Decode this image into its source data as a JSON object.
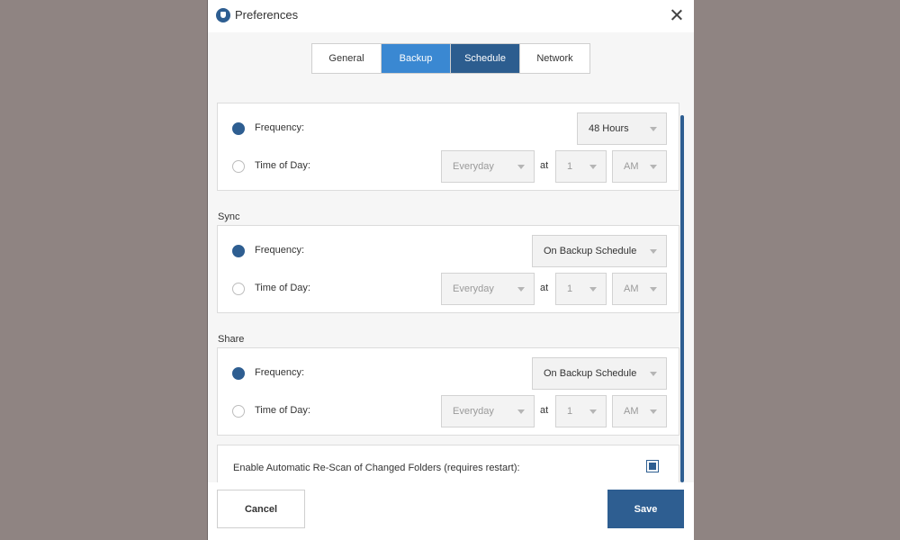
{
  "window": {
    "title": "Preferences"
  },
  "tabs": [
    "General",
    "Backup",
    "Schedule",
    "Network"
  ],
  "sections": {
    "backup": {
      "label": "",
      "frequency_label": "Frequency:",
      "frequency_value": "48 Hours",
      "time_label": "Time of Day:",
      "day_value": "Everyday",
      "at_label": "at",
      "hour_value": "1",
      "ampm_value": "AM"
    },
    "sync": {
      "label": "Sync",
      "frequency_label": "Frequency:",
      "frequency_value": "On Backup Schedule",
      "time_label": "Time of Day:",
      "day_value": "Everyday",
      "at_label": "at",
      "hour_value": "1",
      "ampm_value": "AM"
    },
    "share": {
      "label": "Share",
      "frequency_label": "Frequency:",
      "frequency_value": "On Backup Schedule",
      "time_label": "Time of Day:",
      "day_value": "Everyday",
      "at_label": "at",
      "hour_value": "1",
      "ampm_value": "AM"
    }
  },
  "rescan": {
    "label": "Enable Automatic Re-Scan of Changed Folders (requires restart):"
  },
  "footer": {
    "cancel_label": "Cancel",
    "save_label": "Save"
  },
  "colors": {
    "accent": "#2e5e91",
    "tab_backup": "#3a88d2",
    "backdrop": "#8f8482"
  }
}
